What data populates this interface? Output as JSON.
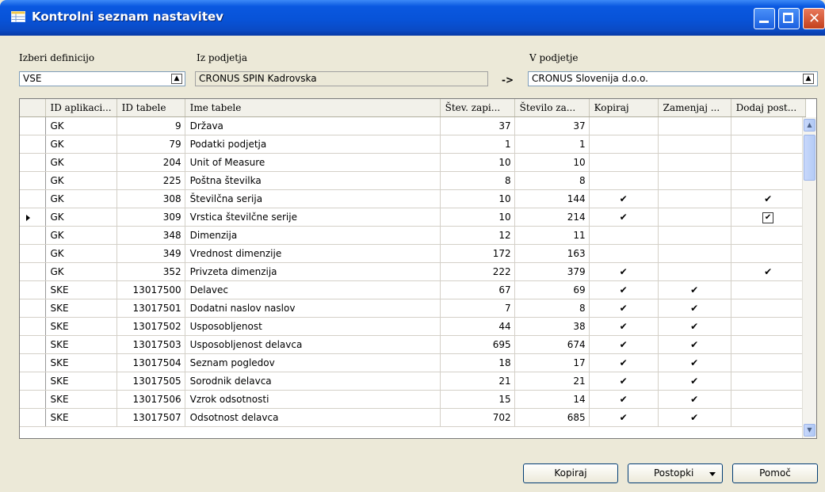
{
  "window": {
    "title": "Kontrolni seznam nastavitev"
  },
  "fields": {
    "definition_label": "Izberi definicijo",
    "definition_value": "VSE",
    "from_label": "Iz podjetja",
    "from_value": "CRONUS SPIN Kadrovska",
    "arrow": "->",
    "to_label": "V podjetje",
    "to_value": "CRONUS Slovenija d.o.o."
  },
  "table": {
    "columns": [
      "ID aplikaci...",
      "ID tabele",
      "Ime tabele",
      "Štev. zapi...",
      "Število za...",
      "Kopiraj",
      "Zamenjaj ...",
      "Dodaj post..."
    ],
    "rows": [
      {
        "app": "GK",
        "id": "9",
        "name": "Država",
        "n1": "37",
        "n2": "37",
        "copy": "",
        "replace": "",
        "add": ""
      },
      {
        "app": "GK",
        "id": "79",
        "name": "Podatki podjetja",
        "n1": "1",
        "n2": "1",
        "copy": "",
        "replace": "",
        "add": ""
      },
      {
        "app": "GK",
        "id": "204",
        "name": "Unit of Measure",
        "n1": "10",
        "n2": "10",
        "copy": "",
        "replace": "",
        "add": ""
      },
      {
        "app": "GK",
        "id": "225",
        "name": "Poštna številka",
        "n1": "8",
        "n2": "8",
        "copy": "",
        "replace": "",
        "add": ""
      },
      {
        "app": "GK",
        "id": "308",
        "name": "Številčna serija",
        "n1": "10",
        "n2": "144",
        "copy": "✔",
        "replace": "",
        "add": "✔"
      },
      {
        "app": "GK",
        "id": "309",
        "name": "Vrstica številčne serije",
        "n1": "10",
        "n2": "214",
        "copy": "✔",
        "replace": "",
        "add": "✔"
      },
      {
        "app": "GK",
        "id": "348",
        "name": "Dimenzija",
        "n1": "12",
        "n2": "11",
        "copy": "",
        "replace": "",
        "add": ""
      },
      {
        "app": "GK",
        "id": "349",
        "name": "Vrednost dimenzije",
        "n1": "172",
        "n2": "163",
        "copy": "",
        "replace": "",
        "add": ""
      },
      {
        "app": "GK",
        "id": "352",
        "name": "Privzeta dimenzija",
        "n1": "222",
        "n2": "379",
        "copy": "✔",
        "replace": "",
        "add": "✔"
      },
      {
        "app": "SKE",
        "id": "13017500",
        "name": "Delavec",
        "n1": "67",
        "n2": "69",
        "copy": "✔",
        "replace": "✔",
        "add": ""
      },
      {
        "app": "SKE",
        "id": "13017501",
        "name": "Dodatni naslov naslov",
        "n1": "7",
        "n2": "8",
        "copy": "✔",
        "replace": "✔",
        "add": ""
      },
      {
        "app": "SKE",
        "id": "13017502",
        "name": "Usposobljenost",
        "n1": "44",
        "n2": "38",
        "copy": "✔",
        "replace": "✔",
        "add": ""
      },
      {
        "app": "SKE",
        "id": "13017503",
        "name": "Usposobljenost delavca",
        "n1": "695",
        "n2": "674",
        "copy": "✔",
        "replace": "✔",
        "add": ""
      },
      {
        "app": "SKE",
        "id": "13017504",
        "name": "Seznam pogledov",
        "n1": "18",
        "n2": "17",
        "copy": "✔",
        "replace": "✔",
        "add": ""
      },
      {
        "app": "SKE",
        "id": "13017505",
        "name": "Sorodnik delavca",
        "n1": "21",
        "n2": "21",
        "copy": "✔",
        "replace": "✔",
        "add": ""
      },
      {
        "app": "SKE",
        "id": "13017506",
        "name": "Vzrok odsotnosti",
        "n1": "15",
        "n2": "14",
        "copy": "✔",
        "replace": "✔",
        "add": ""
      },
      {
        "app": "SKE",
        "id": "13017507",
        "name": "Odsotnost delavca",
        "n1": "702",
        "n2": "685",
        "copy": "✔",
        "replace": "✔",
        "add": ""
      }
    ],
    "selected_row": 5
  },
  "buttons": {
    "copy": "Kopiraj",
    "actions": "Postopki",
    "help": "Pomoč"
  },
  "icons": {
    "window": "table-icon",
    "minimize": "minimize-icon",
    "maximize": "maximize-icon",
    "close": "close-icon",
    "lookup": "lookup-arrow-icon"
  },
  "colors": {
    "titlebar": "#0853d8",
    "close": "#c4401c",
    "background": "#ece9d8"
  }
}
